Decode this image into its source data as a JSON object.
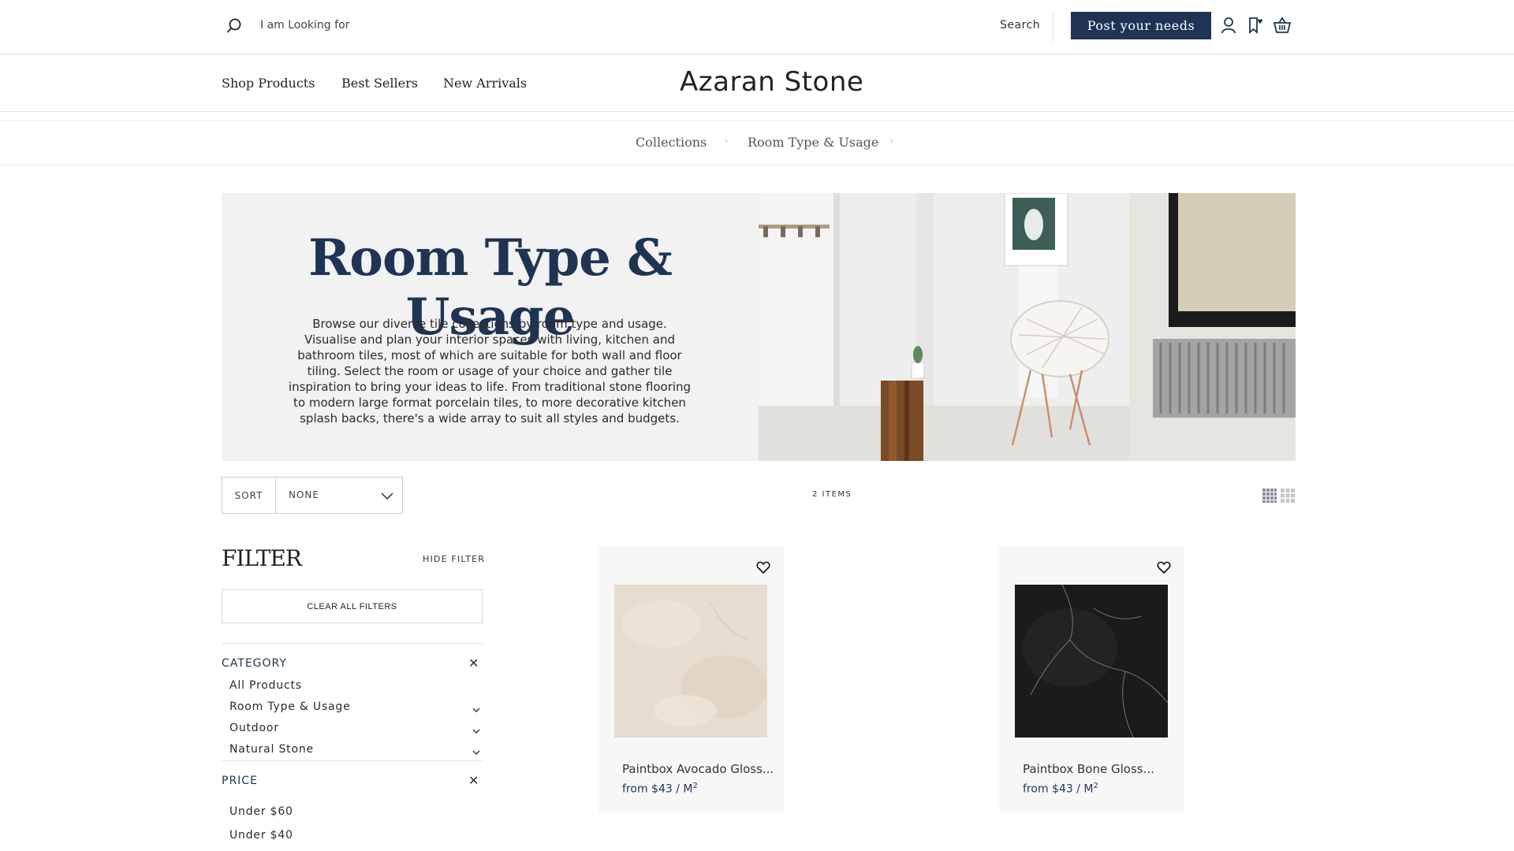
{
  "header": {
    "search_placeholder": "I am Looking for",
    "search_label": "Search",
    "post_needs_label": "Post your needs"
  },
  "nav": {
    "items": [
      "Shop Products",
      "Best Sellers",
      "New Arrivals"
    ],
    "brand": "Azaran Stone"
  },
  "breadcrumb": [
    "Collections",
    "Room Type & Usage"
  ],
  "hero": {
    "title": "Room Type & Usage",
    "description": "Browse our diverse tile collections by room type and usage. Visualise and plan your interior spaces with living, kitchen and bathroom tiles, most of which are suitable for both wall and floor tiling. Select the room or usage of your choice and gather tile inspiration to bring your ideas to life. From traditional stone flooring to modern large format porcelain tiles, to more decorative kitchen splash backs, there's a wide array to suit all styles and budgets."
  },
  "toolbar": {
    "sort_label": "SORT",
    "sort_value": "NONE",
    "items_count": "2 ITEMS"
  },
  "filter": {
    "title": "FILTER",
    "hide_label": "HIDE FILTER",
    "clear_label": "CLEAR ALL FILTERS",
    "category": {
      "title": "CATEGORY",
      "items": [
        "All Products",
        "Room Type & Usage",
        "Outdoor",
        "Natural Stone"
      ]
    },
    "price": {
      "title": "PRICE",
      "items": [
        "Under $60",
        "Under $40"
      ]
    }
  },
  "products": [
    {
      "name": "Paintbox Avocado Gloss...",
      "price": "from $43 / M",
      "unit_sup": "2",
      "swatch": "#e6dccf"
    },
    {
      "name": "Paintbox Bone Gloss...",
      "price": "from $43 / M",
      "unit_sup": "2",
      "swatch": "#1e1e1e"
    }
  ],
  "colors": {
    "navy": "#1f3454",
    "hero_bg": "#f2f2f2",
    "card_bg": "#f7f7f7"
  }
}
